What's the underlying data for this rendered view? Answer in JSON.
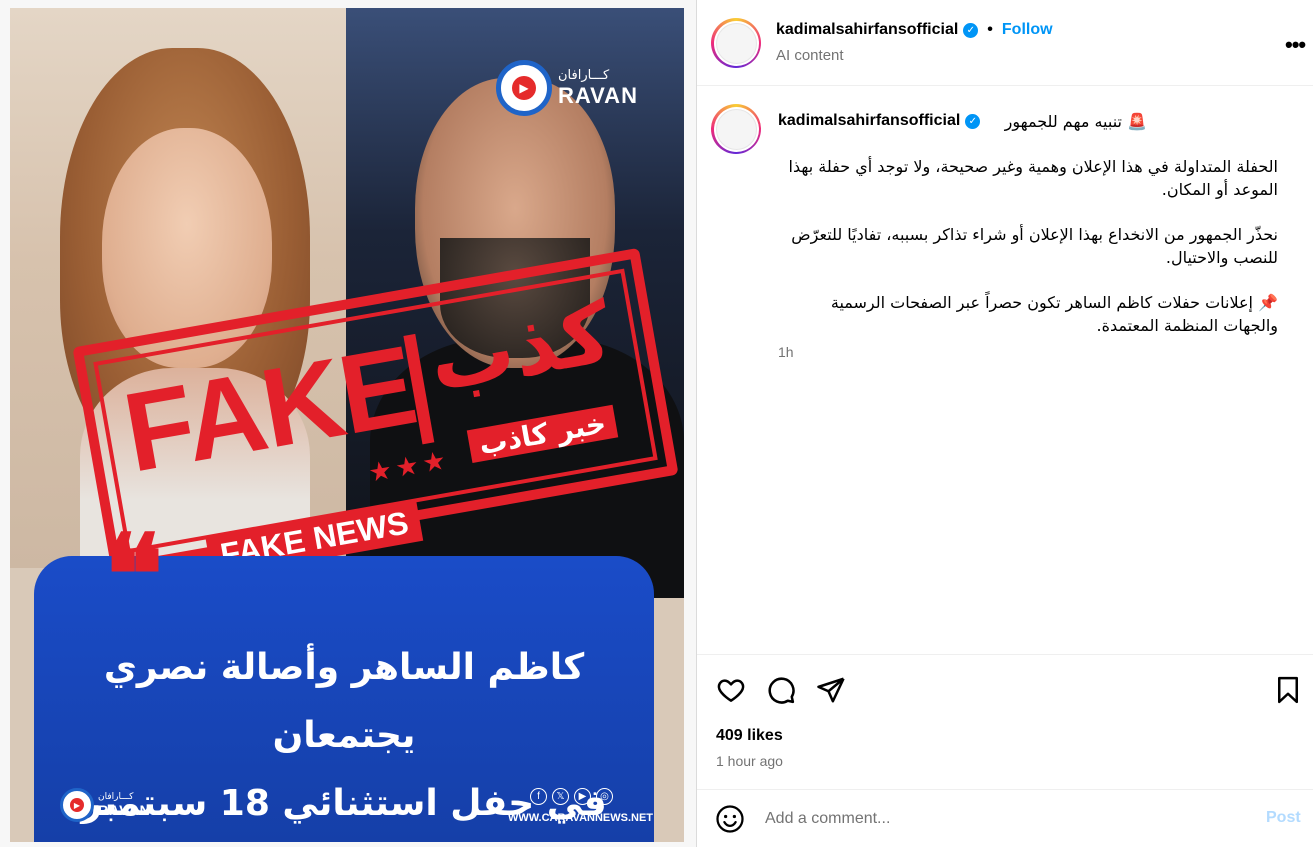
{
  "post_image": {
    "logo_top": {
      "arabic": "كـــارافان",
      "latin": "RAVAN"
    },
    "stamp": {
      "fake": "FAKE",
      "arabic_big": "كذب",
      "stars": "★★★",
      "arabic_sub": "خبر كاذب",
      "fake_news": "FAKE NEWS"
    },
    "quote_mark": "❝",
    "headline_line1": "كاظم الساهر وأصالة نصري يجتمعان",
    "headline_line2": "في حفل استثنائي 18 سبتمبر",
    "logo_bottom": {
      "arabic": "كـــارافان",
      "latin": "RAVAN"
    },
    "socials": [
      "f",
      "𝕏",
      "▶",
      "◎"
    ],
    "website": "WWW.CARAVANNEWS.NET"
  },
  "header": {
    "username": "kadimalsahirfansofficial",
    "verified_mark": "✓",
    "separator": "•",
    "follow_label": "Follow",
    "subtitle": "AI content",
    "more_label": "•••"
  },
  "caption": {
    "username": "kadimalsahirfansofficial",
    "verified_mark": "✓",
    "first_line": "🚨 تنبيه مهم للجمهور",
    "paragraphs": [
      "الحفلة المتداولة في هذا الإعلان وهمية وغير صحيحة، ولا توجد أي حفلة بهذا الموعد أو المكان.",
      "نحذّر الجمهور من الانخداع بهذا الإعلان أو شراء تذاكر بسببه، تفاديًا للتعرّض للنصب والاحتيال.",
      "📌 إعلانات حفلات كاظم الساهر تكون حصراً عبر الصفحات الرسمية والجهات المنظمة المعتمدة."
    ],
    "time": "1h"
  },
  "actions": {
    "likes": "409 likes",
    "time_ago": "1 hour ago"
  },
  "comment": {
    "placeholder": "Add a comment...",
    "post_label": "Post"
  },
  "colors": {
    "accent_blue": "#0095f6",
    "post_disabled": "#b3dbff",
    "stamp_red": "#e3202a",
    "card_blue": "#1a4cc8"
  }
}
